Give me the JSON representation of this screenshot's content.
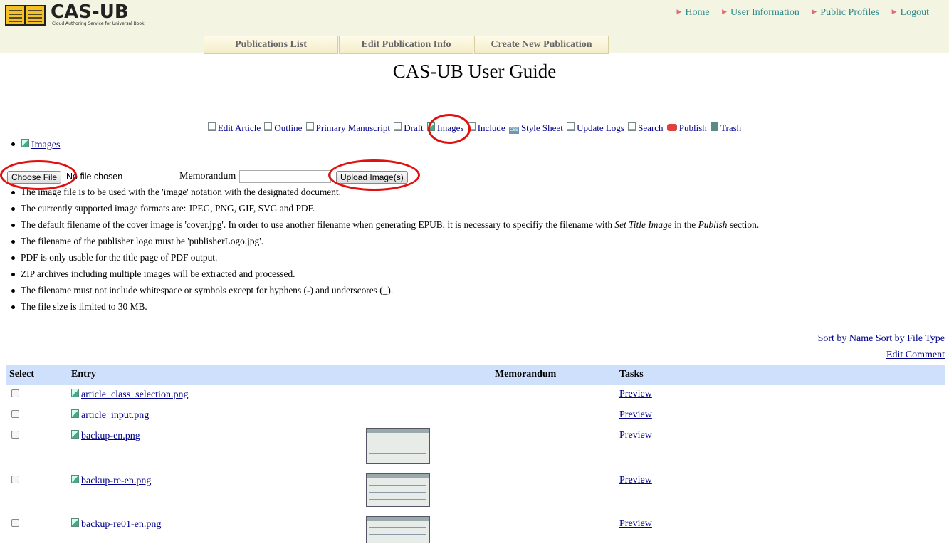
{
  "header": {
    "logo_text": "CAS-UB",
    "logo_subtitle": "Cloud Authoring Service for Universal Book",
    "nav": [
      {
        "label": "Home"
      },
      {
        "label": "User Information"
      },
      {
        "label": "Public Profiles"
      },
      {
        "label": "Logout"
      }
    ],
    "tabs": [
      {
        "label": "Publications List"
      },
      {
        "label": "Edit Publication Info"
      },
      {
        "label": "Create New Publication"
      }
    ]
  },
  "page_title": "CAS-UB User Guide",
  "toolbar": [
    {
      "label": "Edit Article",
      "icon": "document-icon"
    },
    {
      "label": "Outline",
      "icon": "outline-icon"
    },
    {
      "label": "Primary Manuscript",
      "icon": "manuscript-icon"
    },
    {
      "label": "Draft",
      "icon": "draft-icon"
    },
    {
      "label": "Images",
      "icon": "image-icon"
    },
    {
      "label": "Include",
      "icon": "include-icon"
    },
    {
      "label": "Style Sheet",
      "icon": "css-icon"
    },
    {
      "label": "Update Logs",
      "icon": "logs-icon"
    },
    {
      "label": "Search",
      "icon": "search-doc-icon"
    },
    {
      "label": "Publish",
      "icon": "publish-icon"
    },
    {
      "label": "Trash",
      "icon": "trash-icon"
    }
  ],
  "breadcrumb": {
    "label": "Images"
  },
  "upload": {
    "choose_file": "Choose File",
    "no_file": "No file chosen",
    "memo_label": "Memorandum",
    "memo_value": "",
    "upload_button": "Upload Image(s)"
  },
  "info": [
    "The image file is to be used with the 'image' notation with the designated document.",
    "The currently supported image formats are: JPEG, PNG, GIF, SVG and PDF.",
    "The default filename of the cover image is 'cover.jpg'. In order to use another filename when generating EPUB, it is necessary to specifiy the filename with ",
    "The filename of the publisher logo must be 'publisherLogo.jpg'.",
    "PDF is only usable for the title page of PDF output.",
    "ZIP archives including multiple images will be extracted and processed.",
    "The filename must not include whitespace or symbols except for hyphens (-) and underscores (_).",
    "The file size is limited to 30 MB."
  ],
  "info_extra": {
    "set_title_image": "Set Title Image",
    "in_the": " in the ",
    "publish": "Publish",
    "section": " section."
  },
  "sort_links": {
    "by_name": "Sort by Name",
    "by_type": "Sort by File Type",
    "edit_comment": "Edit Comment"
  },
  "table": {
    "headers": {
      "select": "Select",
      "entry": "Entry",
      "memo": "Memorandum",
      "tasks": "Tasks"
    },
    "rows": [
      {
        "entry": "article_class_selection.png",
        "task": "Preview"
      },
      {
        "entry": "article_input.png",
        "task": "Preview"
      },
      {
        "entry": "backup-en.png",
        "task": "Preview"
      },
      {
        "entry": "backup-re-en.png",
        "task": "Preview"
      },
      {
        "entry": "backup-re01-en.png",
        "task": "Preview"
      }
    ]
  },
  "colors": {
    "header_bg": "#f3f4e2",
    "table_header": "#cfe0fc",
    "annotation": "#e01010",
    "nav_link": "#2e8b8b"
  }
}
